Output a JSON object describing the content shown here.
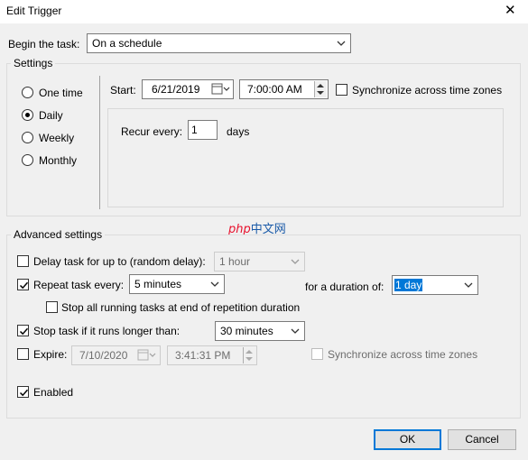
{
  "window": {
    "title": "Edit Trigger",
    "close_glyph": "✕"
  },
  "begin_task": {
    "label": "Begin the task:",
    "value": "On a schedule"
  },
  "settings": {
    "group_label": "Settings",
    "frequency": {
      "options": [
        "One time",
        "Daily",
        "Weekly",
        "Monthly"
      ],
      "selected": "Daily"
    },
    "start": {
      "label": "Start:",
      "date": "6/21/2019",
      "time": "7:00:00 AM"
    },
    "sync_time_zones": {
      "label": "Synchronize across time zones",
      "checked": false
    },
    "recur": {
      "label": "Recur every:",
      "value": "1",
      "unit": "days"
    }
  },
  "watermark": {
    "php": "php",
    "cn": "中文网"
  },
  "advanced": {
    "group_label": "Advanced settings",
    "delay": {
      "label": "Delay task for up to (random delay):",
      "checked": false,
      "value": "1 hour"
    },
    "repeat": {
      "label": "Repeat task every:",
      "checked": true,
      "value": "5 minutes",
      "duration_label": "for a duration of:",
      "duration_value": "1 day"
    },
    "stop_running": {
      "label": "Stop all running tasks at end of repetition duration",
      "checked": false
    },
    "stop_longer": {
      "label": "Stop task if it runs longer than:",
      "checked": true,
      "value": "30 minutes"
    },
    "expire": {
      "label": "Expire:",
      "checked": false,
      "date": "7/10/2020",
      "time": "3:41:31 PM",
      "sync_label": "Synchronize across time zones",
      "sync_checked": false
    },
    "enabled": {
      "label": "Enabled",
      "checked": true
    }
  },
  "buttons": {
    "ok": "OK",
    "cancel": "Cancel"
  },
  "colors": {
    "accent": "#0078d7",
    "watermark_red": "#e8112d",
    "watermark_blue": "#1a5aa8"
  }
}
